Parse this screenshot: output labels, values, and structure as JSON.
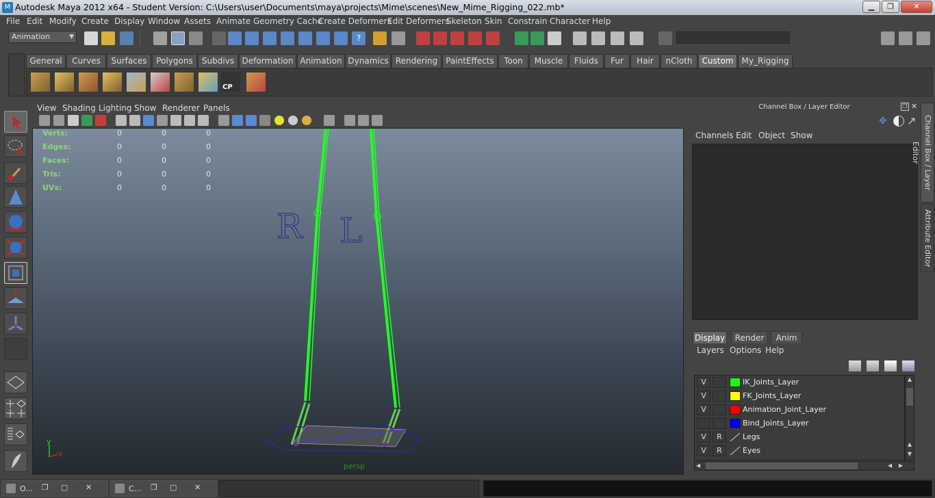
{
  "title": "Autodesk Maya 2012 x64 - Student Version: C:\\Users\\user\\Documents\\maya\\projects\\Mime\\scenes\\New_Mime_Rigging_022.mb*",
  "menus": [
    "File",
    "Edit",
    "Modify",
    "Create",
    "Display",
    "Window",
    "Assets",
    "Animate",
    "Geometry Cache",
    "Create Deformers",
    "Edit Deformers",
    "Skeleton",
    "Skin",
    "Constrain",
    "Character",
    "Help"
  ],
  "menuset": "Animation",
  "shelf_tabs": [
    "General",
    "Curves",
    "Surfaces",
    "Polygons",
    "Subdivs",
    "Deformation",
    "Animation",
    "Dynamics",
    "Rendering",
    "PaintEffects",
    "Toon",
    "Muscle",
    "Fluids",
    "Fur",
    "Hair",
    "nCloth",
    "Custom",
    "My_Rigging"
  ],
  "shelf_active": "Custom",
  "shelf_cp_label": "CP",
  "viewport": {
    "menus": [
      "View",
      "Shading",
      "Lighting",
      "Show",
      "Renderer",
      "Panels"
    ],
    "hud": [
      {
        "label": "Verts:",
        "values": [
          "0",
          "0",
          "0"
        ]
      },
      {
        "label": "Edges:",
        "values": [
          "0",
          "0",
          "0"
        ]
      },
      {
        "label": "Faces:",
        "values": [
          "0",
          "0",
          "0"
        ]
      },
      {
        "label": "Tris:",
        "values": [
          "0",
          "0",
          "0"
        ]
      },
      {
        "label": "UVs:",
        "values": [
          "0",
          "0",
          "0"
        ]
      }
    ],
    "camera": "persp",
    "text_r": "R",
    "text_l": "L",
    "axis_y": "y",
    "axis_x": "x"
  },
  "channel_box": {
    "title": "Channel Box / Layer Editor",
    "menus": [
      "Channels",
      "Edit",
      "Object",
      "Show"
    ]
  },
  "layer_editor": {
    "tabs": [
      "Display",
      "Render",
      "Anim"
    ],
    "active_tab": "Display",
    "menus": [
      "Layers",
      "Options",
      "Help"
    ],
    "layers": [
      {
        "v": "V",
        "r": "",
        "color": "#1aff1a",
        "name": "IK_Joints_Layer"
      },
      {
        "v": "V",
        "r": "",
        "color": "#ffff00",
        "name": "FK_Joints_Layer"
      },
      {
        "v": "V",
        "r": "",
        "color": "#ff0000",
        "name": "Animation_Joint_Layer"
      },
      {
        "v": "",
        "r": "",
        "color": "#0000ff",
        "name": "Bind_Joints_Layer"
      },
      {
        "v": "V",
        "r": "R",
        "color": "",
        "name": "Legs"
      },
      {
        "v": "V",
        "r": "R",
        "color": "",
        "name": "Eyes"
      }
    ]
  },
  "side_tabs": [
    "Channel Box / Layer Editor",
    "Attribute Editor"
  ],
  "taskbar": [
    {
      "label": "O..."
    },
    {
      "label": "C..."
    }
  ],
  "window_buttons": {
    "min": "▁",
    "max": "❐",
    "close": "✕"
  }
}
